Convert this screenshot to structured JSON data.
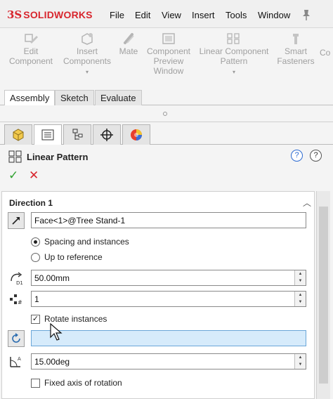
{
  "app": {
    "brand": "SOLIDWORKS",
    "brand_mark": "3S",
    "brand_color": "#d8262e"
  },
  "menu": [
    "File",
    "Edit",
    "View",
    "Insert",
    "Tools",
    "Window"
  ],
  "ribbon": {
    "commands": [
      {
        "label": "Edit\nComponent",
        "icon": "edit-component-icon"
      },
      {
        "label": "Insert\nComponents",
        "icon": "insert-components-icon",
        "has_caret": true
      },
      {
        "label": "Mate",
        "icon": "mate-icon"
      },
      {
        "label": "Component\nPreview\nWindow",
        "icon": "component-preview-window-icon"
      },
      {
        "label": "Linear Component\nPattern",
        "icon": "linear-component-pattern-icon",
        "has_caret": true
      },
      {
        "label": "Smart\nFasteners",
        "icon": "smart-fasteners-icon"
      },
      {
        "label": "Co",
        "icon": ""
      }
    ],
    "caret": "▾"
  },
  "tabs": [
    "Assembly",
    "Sketch",
    "Evaluate"
  ],
  "property_manager": {
    "title": "Linear Pattern",
    "ok_glyph": "✓",
    "cancel_glyph": "✕",
    "help_glyph": "?",
    "direction": {
      "title": "Direction 1",
      "direction_reference": "Face<1>@Tree Stand-1",
      "options": [
        {
          "label": "Spacing and instances",
          "selected": true
        },
        {
          "label": "Up to reference",
          "selected": false
        }
      ],
      "spacing": "50.00mm",
      "instances": "1",
      "rotate_instances": {
        "label": "Rotate instances",
        "checked": true
      },
      "rotation_axis": "",
      "angle": "15.00deg",
      "fixed_axis": {
        "label": "Fixed axis of rotation",
        "checked": false
      }
    }
  },
  "colors": {
    "ok": "#2fa12f",
    "cancel": "#d8262e",
    "selection": "#d6ebfb"
  }
}
